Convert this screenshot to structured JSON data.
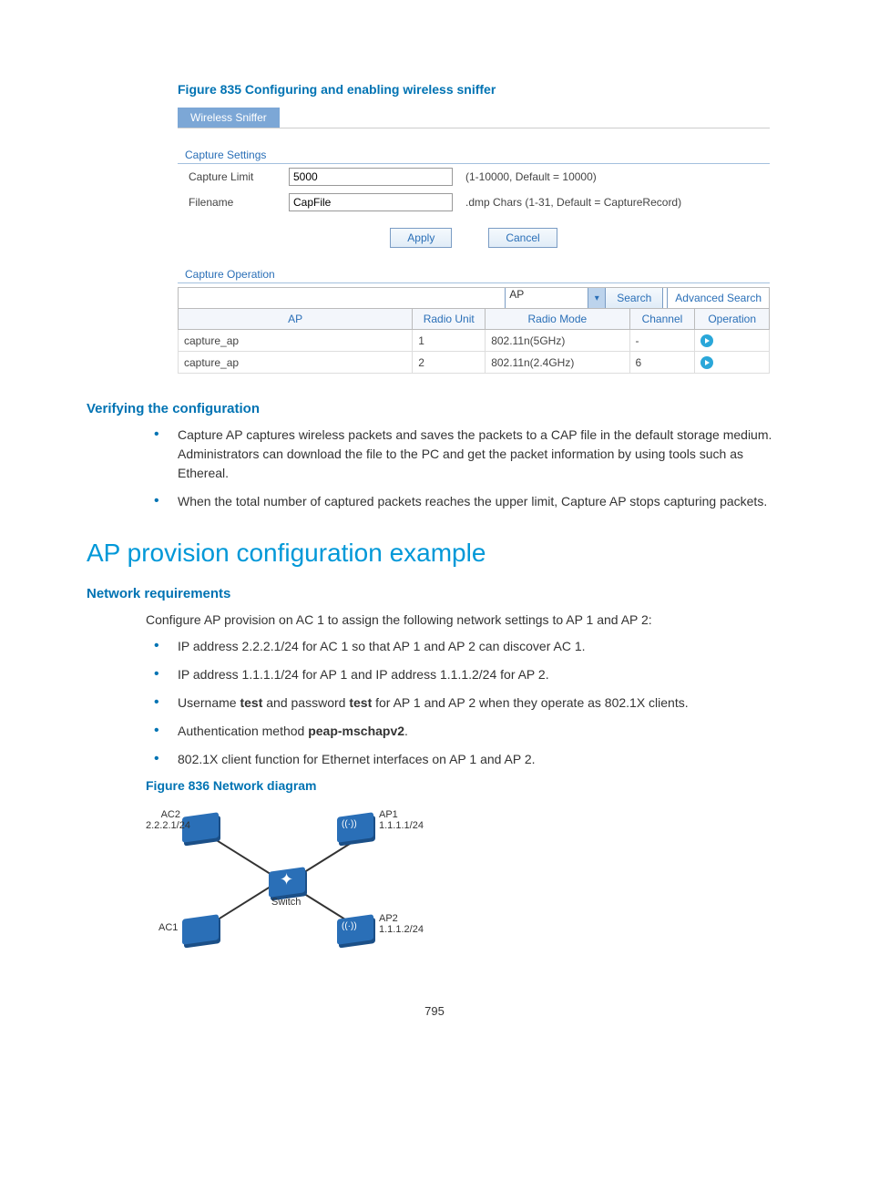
{
  "figure835": {
    "caption": "Figure 835 Configuring and enabling wireless sniffer",
    "tab": "Wireless Sniffer",
    "captureSettingsLabel": "Capture Settings",
    "captureLimit": {
      "label": "Capture Limit",
      "value": "5000",
      "hint": "(1-10000, Default = 10000)"
    },
    "filename": {
      "label": "Filename",
      "value": "CapFile",
      "hint": ".dmp Chars (1-31, Default = CaptureRecord)"
    },
    "applyBtn": "Apply",
    "cancelBtn": "Cancel",
    "captureOperationLabel": "Capture Operation",
    "searchSelect": "AP",
    "searchBtn": "Search",
    "advSearch": "Advanced Search",
    "columns": {
      "ap": "AP",
      "radioUnit": "Radio Unit",
      "radioMode": "Radio Mode",
      "channel": "Channel",
      "operation": "Operation"
    },
    "rows": [
      {
        "ap": "capture_ap",
        "radioUnit": "1",
        "radioMode": "802.11n(5GHz)",
        "channel": "-"
      },
      {
        "ap": "capture_ap",
        "radioUnit": "2",
        "radioMode": "802.11n(2.4GHz)",
        "channel": "6"
      }
    ]
  },
  "verifying": {
    "heading": "Verifying the configuration",
    "bullets": [
      "Capture AP captures wireless packets and saves the packets to a CAP file in the default storage medium. Administrators can download the file to the PC and get the packet information by using tools such as Ethereal.",
      "When the total number of captured packets reaches the upper limit, Capture AP stops capturing packets."
    ]
  },
  "apProvision": {
    "heading": "AP provision configuration example",
    "netReqHeading": "Network requirements",
    "intro": "Configure AP provision on AC 1 to assign the following network settings to AP 1 and AP 2:",
    "bullets": [
      {
        "text": "IP address 2.2.2.1/24 for AC 1 so that AP 1 and AP 2 can discover AC 1."
      },
      {
        "text": "IP address 1.1.1.1/24 for AP 1 and IP address 1.1.1.2/24 for AP 2."
      },
      {
        "pre": "Username ",
        "b1": "test",
        "mid": " and password ",
        "b2": "test",
        "post": " for AP 1 and AP 2 when they operate as 802.1X clients."
      },
      {
        "pre": "Authentication method ",
        "b1": "peap-mschapv2",
        "post": "."
      },
      {
        "text": "802.1X client function for Ethernet interfaces on AP 1 and AP 2."
      }
    ]
  },
  "figure836": {
    "caption": "Figure 836 Network diagram",
    "labels": {
      "ac2": "AC2",
      "ac2ip": "2.2.2.1/24",
      "ap1": "AP1",
      "ap1ip": "1.1.1.1/24",
      "switch": "Switch",
      "ac1": "AC1",
      "ap2": "AP2",
      "ap2ip": "1.1.1.2/24"
    }
  },
  "pageNumber": "795"
}
